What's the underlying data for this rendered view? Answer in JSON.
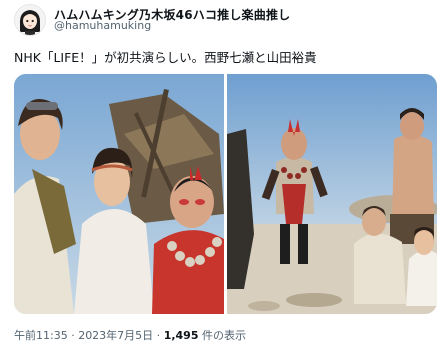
{
  "tweet": {
    "display_name": "ハムハムキング乃木坂46ハコ推し楽曲推し",
    "handle": "@hamuhamuking",
    "text": "NHK「LIFE！」が初共演らしい。西野七瀬と山田裕貴",
    "timestamp": "午前11:35 · 2023年7月5日 ·",
    "views_count": "1,495",
    "views_label": "件の表示"
  },
  "icons": {
    "avatar": "user-avatar-illustration"
  },
  "colors": {
    "text": "#0f1419",
    "secondary": "#536471",
    "background": "#ffffff"
  }
}
